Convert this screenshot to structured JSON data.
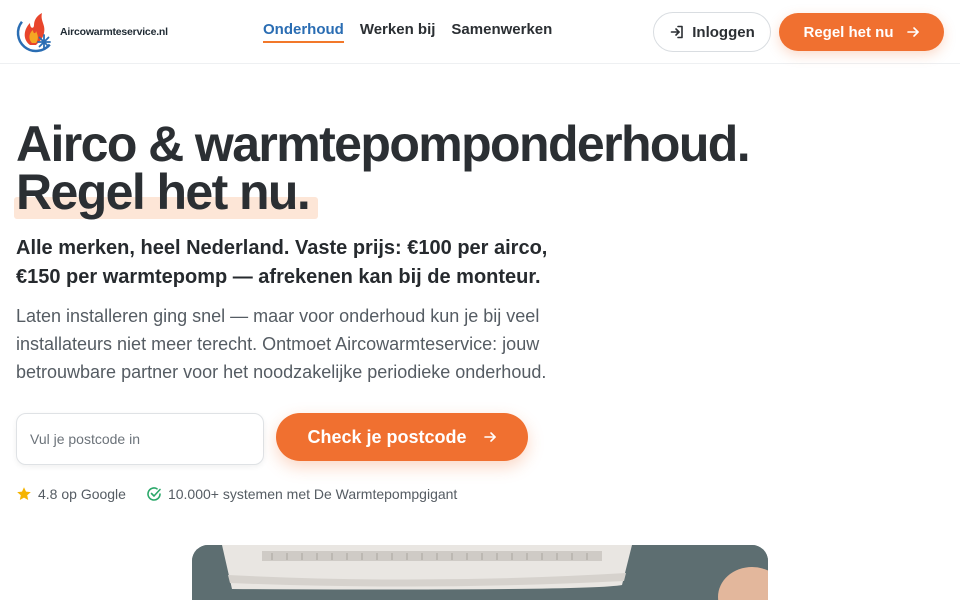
{
  "brand": {
    "name": "Aircowarmteservice.nl",
    "logo_icon": "flame-snowflake-icon"
  },
  "nav": {
    "items": [
      {
        "label": "Onderhoud",
        "active": true
      },
      {
        "label": "Werken bij",
        "active": false
      },
      {
        "label": "Samenwerken",
        "active": false
      }
    ]
  },
  "header": {
    "login_label": "Inloggen",
    "login_icon": "login-icon",
    "cta_label": "Regel het nu",
    "cta_icon": "arrow-right-icon"
  },
  "hero": {
    "headline_line1": "Airco & warmtepomponderhoud.",
    "headline_line2": "Regel het nu.",
    "subhead": "Alle merken, heel Nederland. Vaste prijs: €100 per airco, €150 per warmtepomp — afrekenen kan bij de monteur.",
    "body": "Laten installeren ging snel — maar voor onderhoud kun je bij veel installateurs niet meer terecht. Ontmoet Aircowarmteservice: jouw betrouwbare partner voor het noodzakelijke periodieke onderhoud.",
    "postcode_placeholder": "Vul je postcode in",
    "postcode_value": "",
    "check_label": "Check je postcode",
    "check_icon": "arrow-right-icon"
  },
  "trust": {
    "rating_text": "4.8 op Google",
    "rating_icon": "star-icon",
    "systems_text": "10.000+ systemen met De Warmtepompgigant",
    "systems_icon": "check-circle-icon"
  },
  "colors": {
    "accent": "#f07030",
    "nav_active": "#2a6db3",
    "highlight": "#fde6d7",
    "star": "#f5b400",
    "check": "#2ba86a"
  }
}
